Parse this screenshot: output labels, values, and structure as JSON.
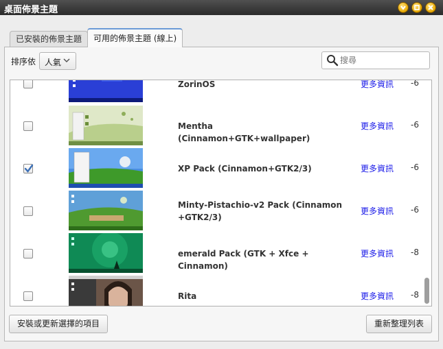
{
  "window": {
    "title": "桌面佈景主題"
  },
  "tabs": [
    {
      "label": "已安裝的佈景主題",
      "active": false
    },
    {
      "label": "可用的佈景主題 (線上)",
      "active": true
    }
  ],
  "toolbar": {
    "sort_label": "排序依",
    "sort_value": "人氣",
    "search_placeholder": "搜尋"
  },
  "themes": [
    {
      "name": "ZorinOS",
      "more": "更多資訊",
      "score": "-6",
      "checked": false
    },
    {
      "name": "Mentha (Cinnamon+GTK+wallpaper)",
      "more": "更多資訊",
      "score": "-6",
      "checked": false
    },
    {
      "name": "XP Pack (Cinnamon+GTK2/3)",
      "more": "更多資訊",
      "score": "-6",
      "checked": true
    },
    {
      "name": "Minty-Pistachio-v2 Pack (Cinnamon +GTK2/3)",
      "more": "更多資訊",
      "score": "-6",
      "checked": false
    },
    {
      "name": "emerald Pack (GTK + Xfce + Cinnamon)",
      "more": "更多資訊",
      "score": "-8",
      "checked": false
    },
    {
      "name": "Rita",
      "more": "更多資訊",
      "score": "-8",
      "checked": false
    }
  ],
  "buttons": {
    "install": "安裝或更新選擇的項目",
    "refresh": "重新整理列表"
  },
  "colors": {
    "link": "#1a1ae8",
    "checkmark": "#3b6fb6",
    "title_bar": "#3a3a3a"
  }
}
